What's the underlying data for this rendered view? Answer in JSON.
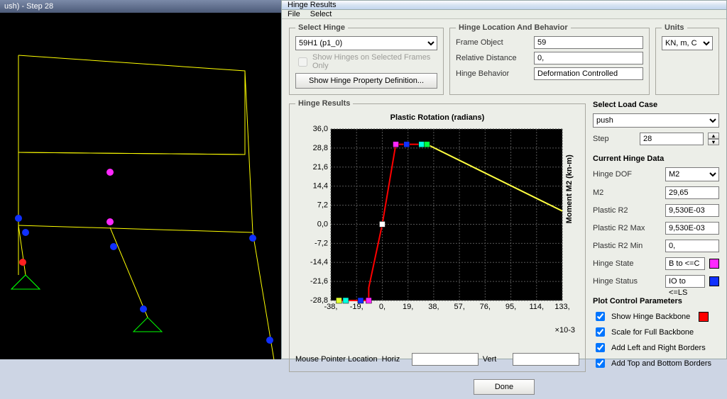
{
  "viewport": {
    "title": "ush) - Step 28"
  },
  "dialog": {
    "title": "Hinge Results",
    "menu": [
      "File",
      "Select"
    ],
    "select_hinge": {
      "legend": "Select Hinge",
      "value": "59H1 (p1_0)",
      "show_frames_label": "Show Hinges on Selected Frames Only",
      "show_def_btn": "Show Hinge Property Definition..."
    },
    "location": {
      "legend": "Hinge Location And Behavior",
      "rows": [
        {
          "label": "Frame Object",
          "value": "59"
        },
        {
          "label": "Relative Distance",
          "value": "0,"
        },
        {
          "label": "Hinge Behavior",
          "value": "Deformation Controlled"
        }
      ]
    },
    "units": {
      "legend": "Units",
      "value": "KN, m, C"
    },
    "hinge_results": {
      "legend": "Hinge Results",
      "chart_title": "Plastic Rotation  (radians)",
      "y_axis_label": "Moment M2  (kn-m)",
      "x_exp": "×10-3",
      "mouse_label": "Mouse Pointer Location",
      "horiz_label": "Horiz",
      "vert_label": "Vert",
      "horiz_val": "",
      "vert_val": ""
    },
    "load_case": {
      "head": "Select Load Case",
      "value": "push",
      "step_label": "Step",
      "step_value": "28"
    },
    "current": {
      "head": "Current Hinge Data",
      "dof_label": "Hinge DOF",
      "dof_value": "M2",
      "m2_label": "M2",
      "m2_value": "29,65",
      "pr2_label": "Plastic R2",
      "pr2_value": "9,530E-03",
      "pr2max_label": "Plastic R2 Max",
      "pr2max_value": "9,530E-03",
      "pr2min_label": "Plastic R2 Min",
      "pr2min_value": "0,",
      "state_label": "Hinge State",
      "state_value": "B to <=C",
      "state_color": "#ff28ff",
      "status_label": "Hinge Status",
      "status_value": "IO to <=LS",
      "status_color": "#1030ff"
    },
    "plot": {
      "head": "Plot Control Parameters",
      "backbone": "Show Hinge Backbone",
      "backbone_color": "#ff0000",
      "scale": "Scale for Full Backbone",
      "lr": "Add Left and Right Borders",
      "tb": "Add Top and Bottom Borders"
    },
    "done": "Done"
  },
  "chart_data": {
    "type": "line",
    "title": "Plastic Rotation (radians)",
    "xlabel": "Plastic Rotation (radians) ×10-3",
    "ylabel": "Moment M2 (kn-m)",
    "x_ticks": [
      -38,
      -19,
      0,
      19,
      38,
      57,
      76,
      95,
      114,
      133
    ],
    "y_ticks": [
      -28.8,
      -21.6,
      -14.4,
      -7.2,
      0.0,
      7.2,
      14.4,
      21.6,
      28.8,
      36.0
    ],
    "series": [
      {
        "name": "Hinge Backbone",
        "color": "#ff0000",
        "points": [
          {
            "x": -32,
            "y": -28.8
          },
          {
            "x": -10,
            "y": -28.8
          },
          {
            "x": -10,
            "y": -24.0
          },
          {
            "x": 0,
            "y": 0.0
          },
          {
            "x": 10,
            "y": 30.2
          },
          {
            "x": 33,
            "y": 30.2
          }
        ]
      },
      {
        "name": "Post-peak",
        "color": "#ffff40",
        "points": [
          {
            "x": 33,
            "y": 30.2
          },
          {
            "x": 133,
            "y": 5.0
          }
        ]
      }
    ],
    "markers": [
      {
        "x": 10,
        "y": 30.2,
        "color": "#ff28ff"
      },
      {
        "x": 18,
        "y": 30.2,
        "color": "#1030ff"
      },
      {
        "x": 29,
        "y": 30.2,
        "color": "#00ffe0"
      },
      {
        "x": 33,
        "y": 30.2,
        "color": "#00ff40"
      },
      {
        "x": 0,
        "y": 0.0,
        "color": "#ffffff"
      },
      {
        "x": -10,
        "y": -28.8,
        "color": "#ff28ff"
      },
      {
        "x": -16,
        "y": -28.8,
        "color": "#1030ff"
      },
      {
        "x": -27,
        "y": -28.8,
        "color": "#00ffe0"
      },
      {
        "x": -32,
        "y": -28.8,
        "color": "#dfff30"
      }
    ],
    "current_point": {
      "x": 9.53,
      "y": 29.65
    }
  }
}
